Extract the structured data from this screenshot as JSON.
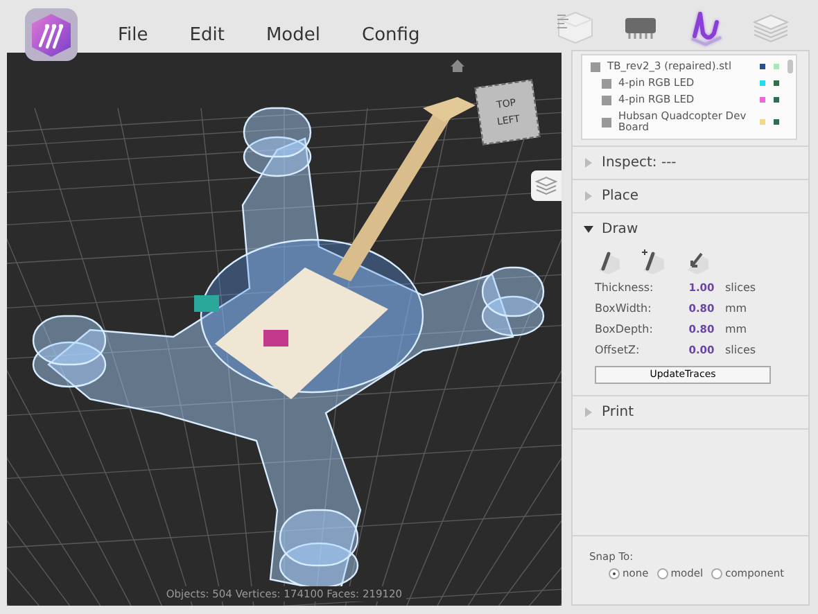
{
  "menu": [
    "File",
    "Edit",
    "Model",
    "Config"
  ],
  "toolbar": [
    {
      "kind": "list",
      "selected": false
    },
    {
      "kind": "chip",
      "selected": false
    },
    {
      "kind": "trace",
      "selected": true
    },
    {
      "kind": "layers",
      "selected": false
    }
  ],
  "viewport": {
    "view_cube": {
      "top": "TOP",
      "side": "LEFT"
    },
    "status": "Objects: 504 Vertices: 174100 Faces: 219120"
  },
  "tree": [
    {
      "label": "TB_rev2_3 (repaired).stl",
      "swatches": [
        {
          "color": "#2a4f8f"
        },
        {
          "color": "#a8e8b8"
        }
      ],
      "children": [
        {
          "label": "4-pin RGB LED",
          "swatches": [
            {
              "color": "#22ddee"
            },
            {
              "color": "#2e6e4a"
            }
          ]
        },
        {
          "label": "4-pin RGB LED",
          "swatches": [
            {
              "color": "#ee66dd"
            },
            {
              "color": "#2e6e4a"
            }
          ]
        },
        {
          "label": "Hubsan Quadcopter Dev Board",
          "swatches": [
            {
              "color": "#f4d88a"
            },
            {
              "color": "#2e6e4a"
            }
          ]
        }
      ]
    }
  ],
  "sections": [
    {
      "title": "Inspect: ---",
      "expanded": false
    },
    {
      "title": "Place",
      "expanded": false
    },
    {
      "title": "Draw",
      "expanded": true
    },
    {
      "title": "Print",
      "expanded": false
    }
  ],
  "draw": {
    "tools": [
      {
        "kind": "pen"
      },
      {
        "kind": "pen-plus"
      },
      {
        "kind": "pen-erase"
      }
    ],
    "fields": [
      {
        "label": "Thickness:",
        "value": "1.00",
        "unit": "slices"
      },
      {
        "label": "BoxWidth:",
        "value": "0.80",
        "unit": "mm"
      },
      {
        "label": "BoxDepth:",
        "value": "0.80",
        "unit": "mm"
      },
      {
        "label": "OffsetZ:",
        "value": "0.00",
        "unit": "slices"
      }
    ],
    "button": "UpdateTraces"
  },
  "snap": {
    "label": "Snap To:",
    "options": [
      {
        "label": "none",
        "selected": true
      },
      {
        "label": "model",
        "selected": false
      },
      {
        "label": "component",
        "selected": false
      }
    ]
  }
}
